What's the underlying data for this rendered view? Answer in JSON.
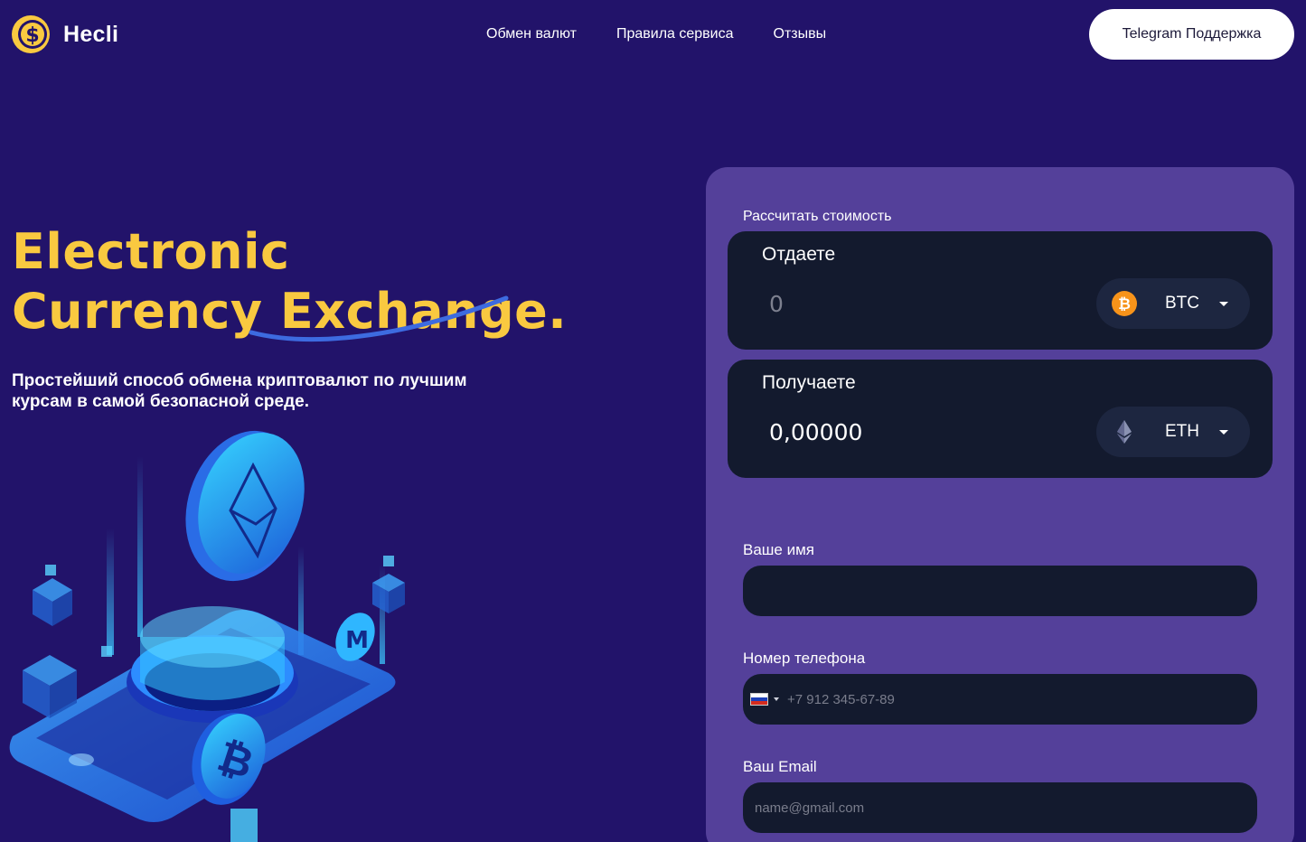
{
  "brand": {
    "name": "Hecli",
    "logo_color": "#f9c940"
  },
  "nav": [
    {
      "label": "Обмен валют"
    },
    {
      "label": "Правила сервиса"
    },
    {
      "label": "Отзывы"
    }
  ],
  "header": {
    "support_button": "Telegram Поддержка"
  },
  "hero": {
    "title_line1": "Electronic",
    "title_line2": "Currency Exchange.",
    "subtitle_line1": "Простейший способ обмена криптовалют по лучшим",
    "subtitle_line2": "курсам в самой безопасной среде."
  },
  "exchange": {
    "calc_label": "Рассчитать стоимость",
    "give": {
      "caption": "Отдаете",
      "amount": "0",
      "currency": "BTC",
      "icon": "bitcoin-icon"
    },
    "get": {
      "caption": "Получаете",
      "amount": "0,00000",
      "currency": "ETH",
      "icon": "ethereum-icon"
    }
  },
  "form": {
    "name_label": "Ваше имя",
    "name_value": "",
    "phone_label": "Номер телефона",
    "phone_placeholder": "+7 912 345-67-89",
    "email_label": "Ваш Email",
    "email_placeholder": "name@gmail.com"
  },
  "colors": {
    "page_bg": "#22136a",
    "panel_bg": "#54409a",
    "field_bg": "#131a2e",
    "accent_yellow": "#f9c940",
    "bitcoin_orange": "#f7931a"
  }
}
